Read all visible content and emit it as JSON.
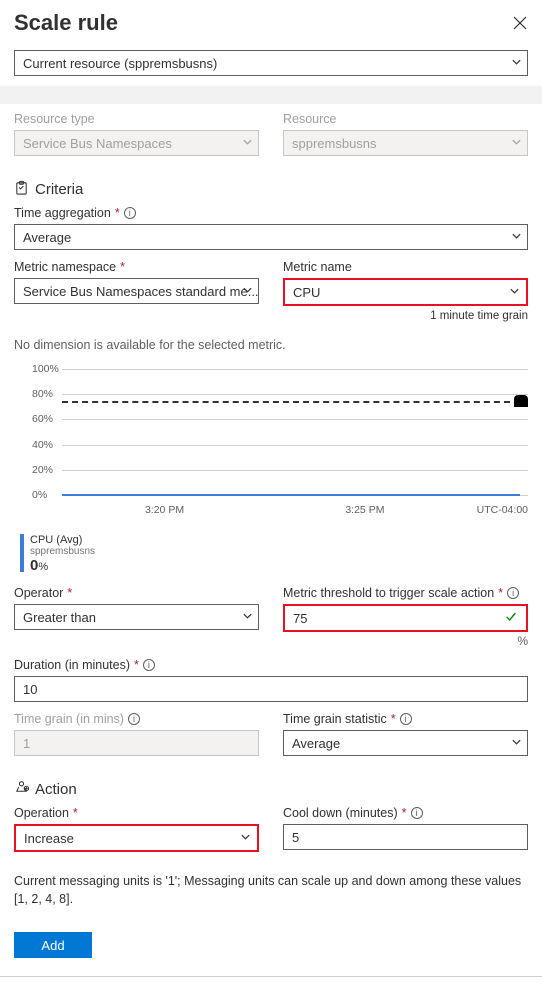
{
  "header": {
    "title": "Scale rule"
  },
  "resource_select": {
    "value": "Current resource (sppremsbusns)"
  },
  "resource_type": {
    "label": "Resource type",
    "value": "Service Bus Namespaces"
  },
  "resource": {
    "label": "Resource",
    "value": "sppremsbusns"
  },
  "criteria": {
    "title": "Criteria"
  },
  "time_aggregation": {
    "label": "Time aggregation",
    "value": "Average"
  },
  "metric_namespace": {
    "label": "Metric namespace",
    "value": "Service Bus Namespaces standard me..."
  },
  "metric_name": {
    "label": "Metric name",
    "value": "CPU",
    "grain_note": "1 minute time grain"
  },
  "no_dimension": "No dimension is available for the selected metric.",
  "operator": {
    "label": "Operator",
    "value": "Greater than"
  },
  "threshold": {
    "label": "Metric threshold to trigger scale action",
    "value": "75",
    "suffix": "%"
  },
  "duration": {
    "label": "Duration (in minutes)",
    "value": "10"
  },
  "time_grain": {
    "label": "Time grain (in mins)",
    "value": "1"
  },
  "time_grain_stat": {
    "label": "Time grain statistic",
    "value": "Average"
  },
  "action": {
    "title": "Action"
  },
  "operation": {
    "label": "Operation",
    "value": "Increase"
  },
  "cooldown": {
    "label": "Cool down (minutes)",
    "value": "5"
  },
  "messaging_note": "Current messaging units is '1'; Messaging units can scale up and down among these values [1, 2, 4, 8].",
  "add_button": "Add",
  "chart_data": {
    "type": "line",
    "title": "",
    "ylabel": "",
    "xlabel": "",
    "ylim": [
      0,
      100
    ],
    "y_ticks": [
      "100%",
      "80%",
      "60%",
      "40%",
      "20%",
      "0%"
    ],
    "x_ticks": [
      "3:20 PM",
      "3:25 PM"
    ],
    "timezone": "UTC-04:00",
    "threshold_line": 75,
    "series": [
      {
        "name": "CPU (Avg)",
        "resource": "sppremsbusns",
        "current_value": "0",
        "current_unit": "%",
        "approx_level": 0
      }
    ]
  }
}
